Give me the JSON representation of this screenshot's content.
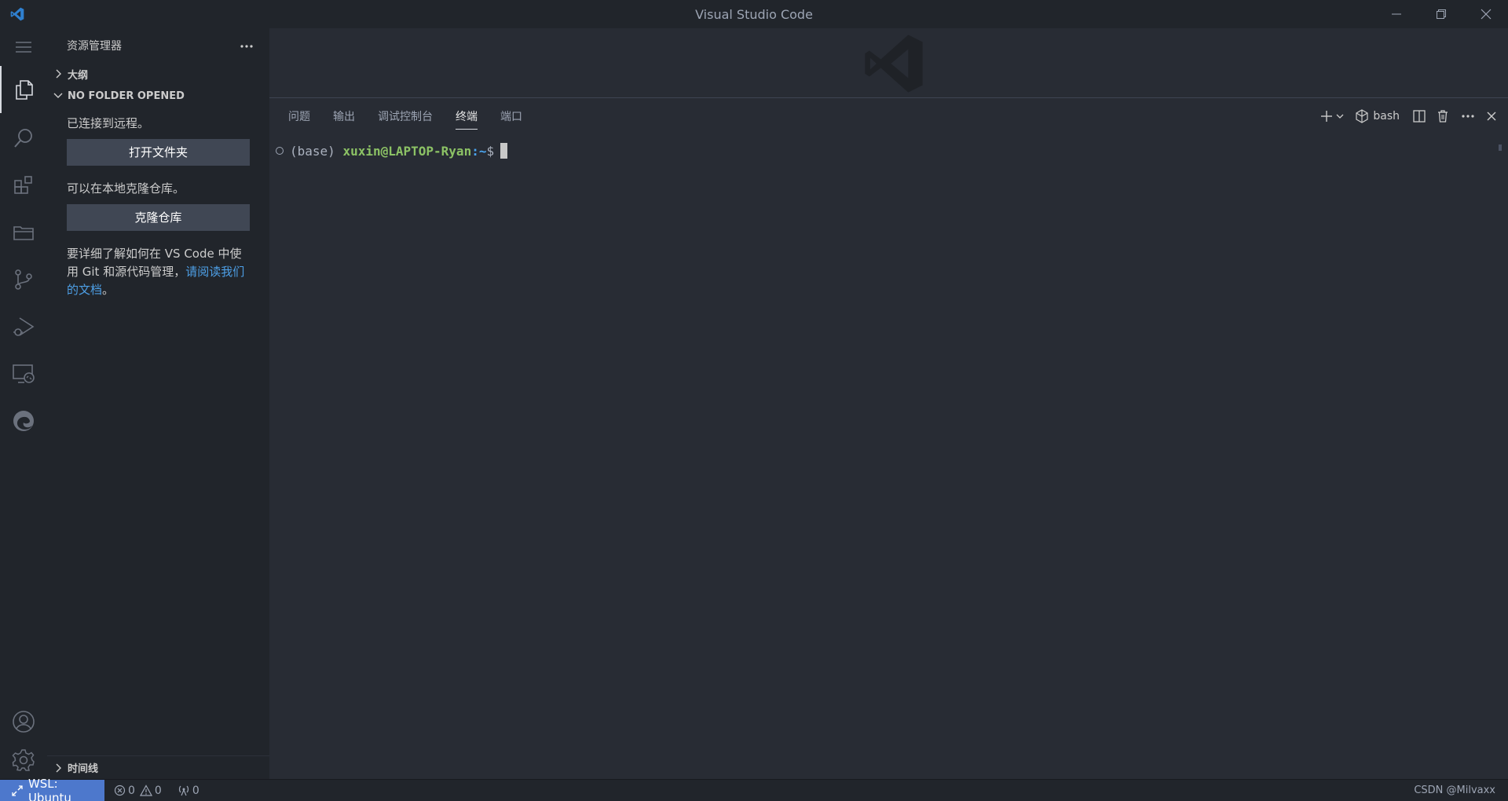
{
  "window": {
    "title": "Visual Studio Code"
  },
  "sidebar": {
    "title": "资源管理器",
    "outline_label": "大纲",
    "folder_section_label": "NO FOLDER OPENED",
    "connected_text": "已连接到远程。",
    "open_folder_button": "打开文件夹",
    "clone_text": "可以在本地克隆仓库。",
    "clone_button": "克隆仓库",
    "learn_text": "要详细了解如何在 VS Code 中使用 Git 和源代码管理，",
    "learn_link": "请阅读我们的文档",
    "learn_end": "。",
    "timeline_label": "时间线"
  },
  "panel": {
    "tabs": [
      {
        "label": "问题"
      },
      {
        "label": "输出"
      },
      {
        "label": "调试控制台"
      },
      {
        "label": "终端"
      },
      {
        "label": "端口"
      }
    ],
    "active_tab": "终端",
    "shell_label": "bash"
  },
  "terminal": {
    "env": "(base)",
    "user_host": "xuxin@LAPTOP-Ryan",
    "path": ":~",
    "prompt": "$"
  },
  "statusbar": {
    "remote": "WSL: Ubuntu",
    "errors": "0",
    "warnings": "0",
    "ports": "0",
    "credit": "CSDN @Milvaxx"
  },
  "colors": {
    "accent_remote": "#4d78cc",
    "link": "#4d9fe6",
    "terminal_user": "#8cc265",
    "terminal_path": "#4aa5f0"
  }
}
